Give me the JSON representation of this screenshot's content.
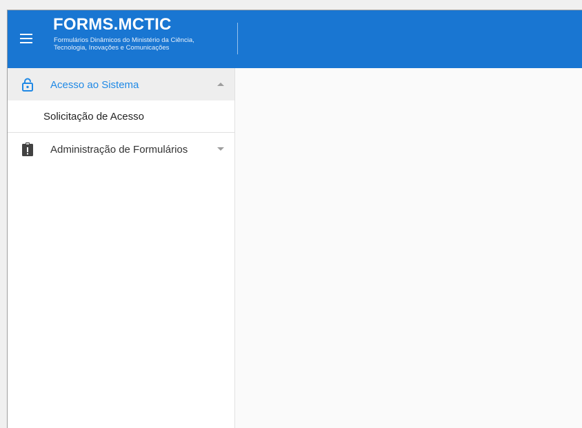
{
  "theme": {
    "brand": "#1976d2",
    "accent": "#1e88e5"
  },
  "header": {
    "title": "FORMS.MCTIC",
    "subtitle": "Formulários Dinâmicos do Ministério da Ciência, Tecnologia, Inovações e Comunicações",
    "menu_icon": "hamburger-menu-icon"
  },
  "sidebar": {
    "groups": [
      {
        "label": "Acesso ao Sistema",
        "icon": "lock-open-icon",
        "expanded": true,
        "items": [
          {
            "label": "Solicitação de Acesso"
          }
        ]
      },
      {
        "label": "Administração de Formulários",
        "icon": "clipboard-alert-icon",
        "expanded": false,
        "items": []
      }
    ]
  }
}
